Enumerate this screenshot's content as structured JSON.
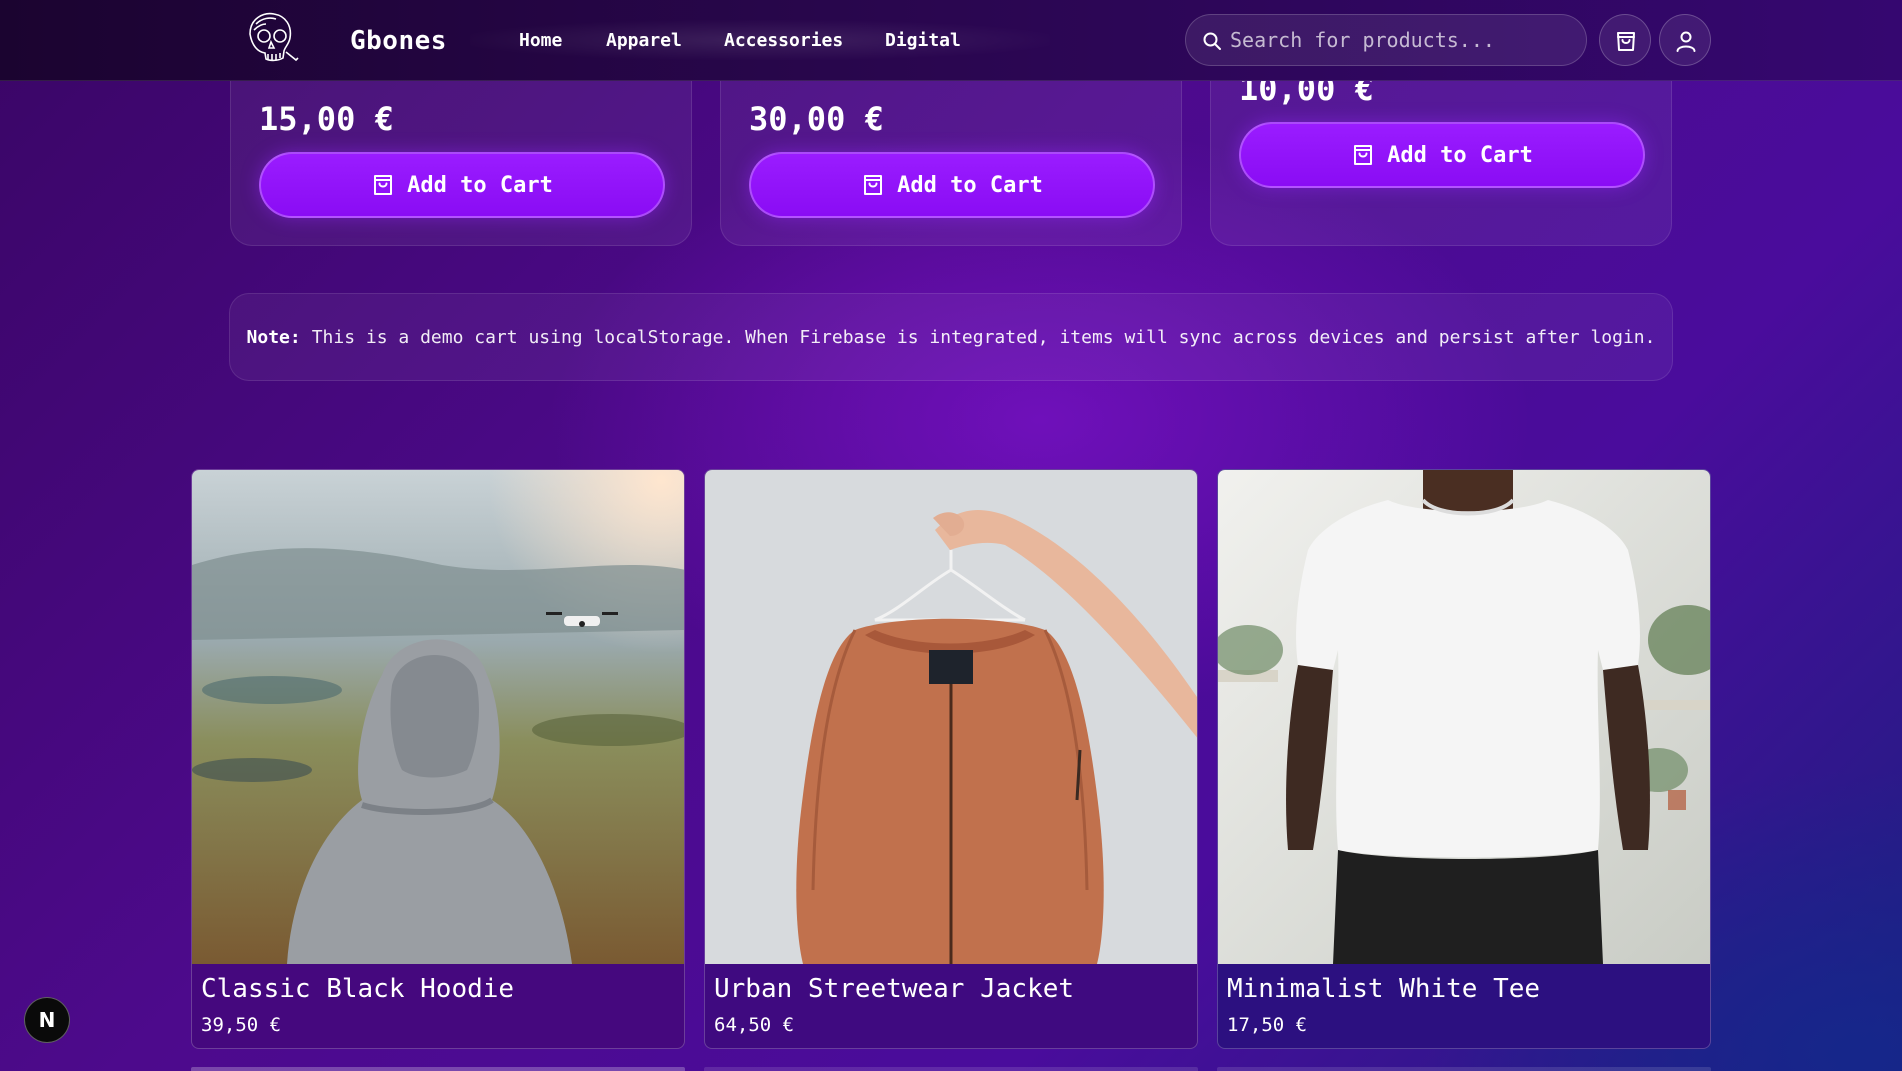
{
  "header": {
    "brand": "Gbones",
    "nav": [
      {
        "label": "Home"
      },
      {
        "label": "Apparel"
      },
      {
        "label": "Accessories"
      },
      {
        "label": "Digital"
      }
    ],
    "search_placeholder": "Search for products...",
    "icons": {
      "logo": "skull-logo",
      "search": "search-icon",
      "cart": "shopping-bag-icon",
      "account": "user-icon"
    }
  },
  "partial_products": [
    {
      "price": "15,00 €",
      "button": "Add to Cart"
    },
    {
      "price": "30,00 €",
      "button": "Add to Cart"
    },
    {
      "price": "10,00 €",
      "button": "Add to Cart"
    }
  ],
  "note": {
    "label": "Note:",
    "text": "This is a demo cart using localStorage. When Firebase is integrated, items will sync across devices and persist after login."
  },
  "products": [
    {
      "title": "Classic Black Hoodie",
      "price": "39,50 €"
    },
    {
      "title": "Urban Streetwear Jacket",
      "price": "64,50 €"
    },
    {
      "title": "Minimalist White Tee",
      "price": "17,50 €"
    }
  ],
  "dev_badge": "N",
  "colors": {
    "accent": "#8a0cf4",
    "background": "#4d0a8c",
    "header": "#2a0650"
  }
}
